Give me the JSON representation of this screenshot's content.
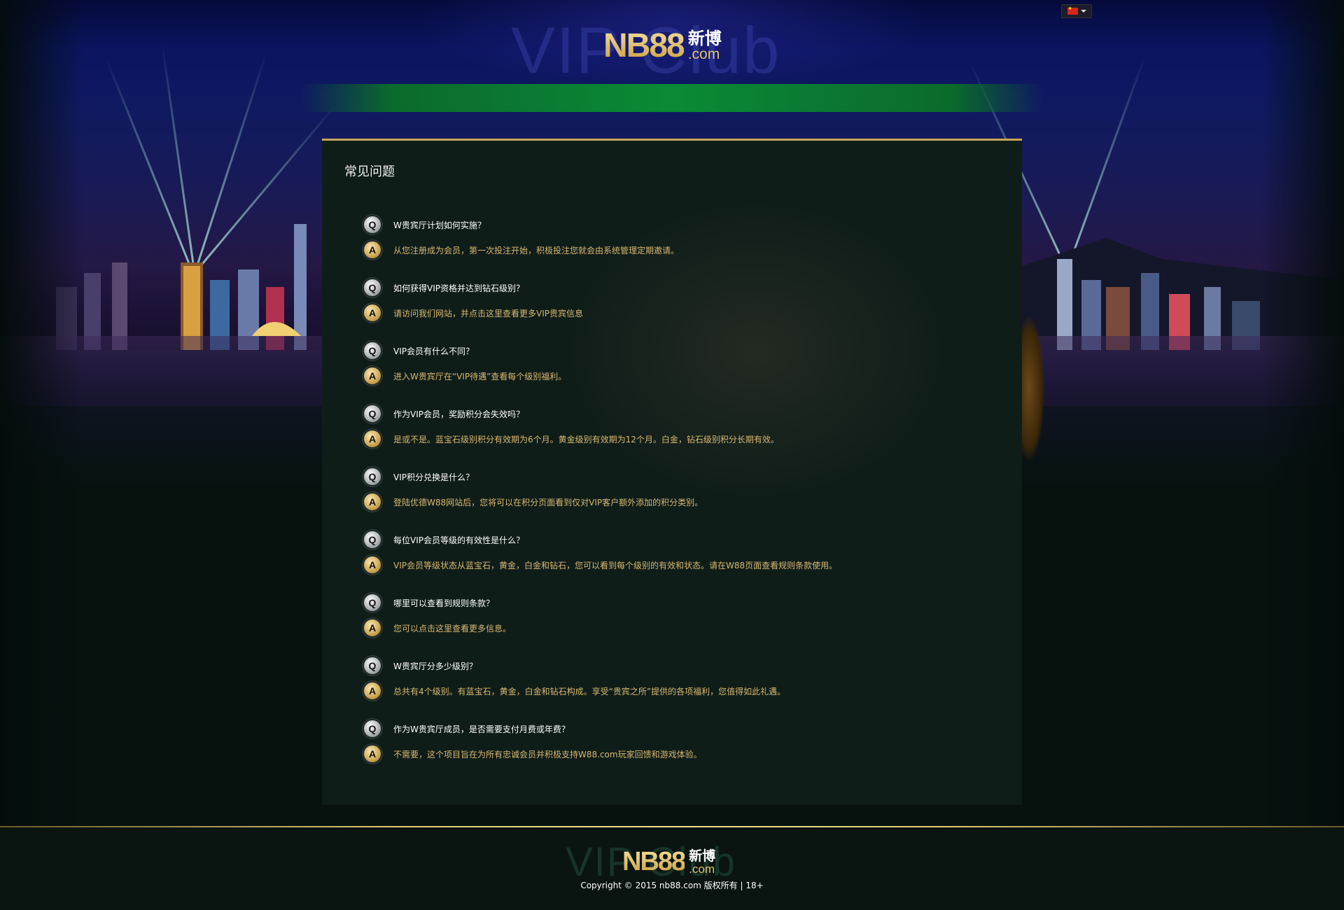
{
  "header": {
    "logo_ghost": "VIP Club",
    "logo_main": "NB88",
    "logo_cn": "新博",
    "logo_com": ".com",
    "language_icon": "china-flag-icon"
  },
  "faq": {
    "title": "常见问题",
    "items": [
      {
        "q": "W贵宾厅计划如何实施？",
        "a": "从您注册成为会员，第一次投注开始，积极投注您就会由系统管理定期邀请。"
      },
      {
        "q": "如何获得VIP资格并达到钻石级别？",
        "a": "请访问我们网站，并点击这里查看更多VIP贵宾信息"
      },
      {
        "q": "VIP会员有什么不同？",
        "a": "进入W贵宾厅在“VIP待遇”查看每个级别福利。"
      },
      {
        "q": "作为VIP会员，奖励积分会失效吗？",
        "a": "是或不是。蓝宝石级别积分有效期为6个月。黄金级别有效期为12个月。白金，钻石级别积分长期有效。"
      },
      {
        "q": "VIP积分兑换是什么？",
        "a": "登陆优德W88网站后，您将可以在积分页面看到仅对VIP客户额外添加的积分类别。"
      },
      {
        "q": "每位VIP会员等级的有效性是什么？",
        "a": "VIP会员等级状态从蓝宝石，黄金，白金和钻石，您可以看到每个级别的有效和状态。请在W88页面查看规则条款使用。"
      },
      {
        "q": "哪里可以查看到规则条款？",
        "a": "您可以点击这里查看更多信息。"
      },
      {
        "q": "W贵宾厅分多少级别？",
        "a": "总共有4个级别。有蓝宝石，黄金，白金和钻石构成。享受“贵宾之所”提供的各项福利，您值得如此礼遇。"
      },
      {
        "q": "作为W贵宾厅成员，是否需要支付月费或年费？",
        "a": "不需要，这个项目旨在为所有忠诚会员并积极支持W88.com玩家回馈和游戏体验。"
      }
    ],
    "q_badge": "Q",
    "a_badge": "A"
  },
  "footer": {
    "logo_ghost": "VIP Club",
    "logo_main": "NB88",
    "logo_cn": "新博",
    "logo_com": ".com",
    "copyright": "Copyright © 2015 nb88.com  版权所有 | 18+"
  },
  "colors": {
    "accent_gold": "#e2c06c",
    "answer_text": "#d8b870",
    "panel_bg": "#0f1d19",
    "green_bar": "#0a8a36"
  }
}
